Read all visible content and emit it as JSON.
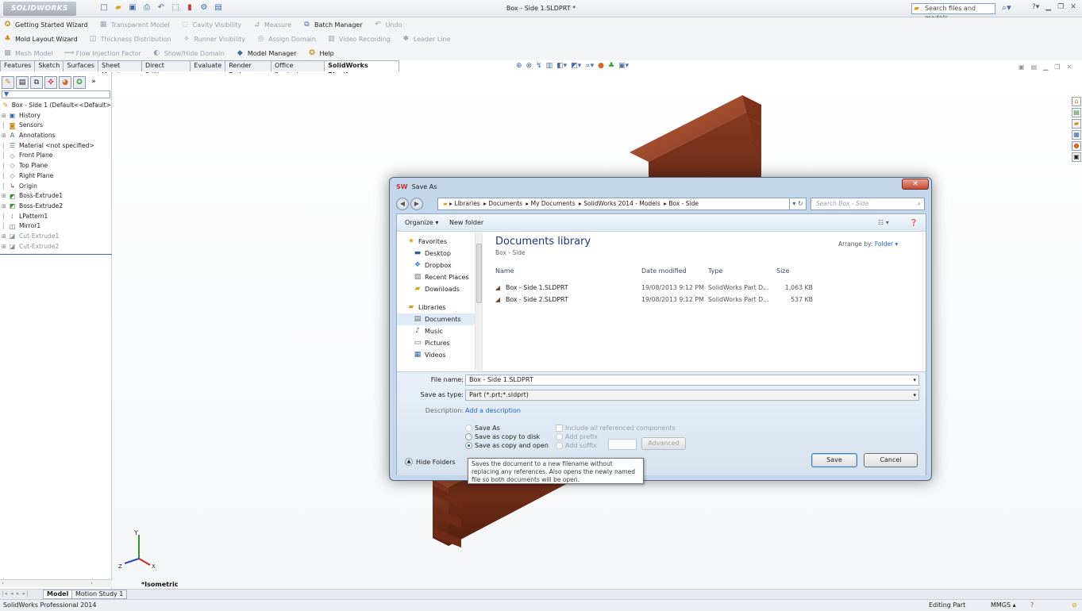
{
  "app": {
    "logo_text": "SOLIDWORKS",
    "document_title": "Box - Side 1.SLDPRT *",
    "search_placeholder": "Search files and models"
  },
  "command_manager": {
    "row1": [
      "Getting Started Wizard",
      "Transparent Model",
      "Cavity Visibility",
      "Measure",
      "Batch Manager",
      "Undo"
    ],
    "row2": [
      "Mold Layout Wizard",
      "Thickness Distribution",
      "Runner Visibility",
      "Assign Domain",
      "Video Recording",
      "Leader Line"
    ],
    "row3": [
      "Mesh Model",
      "Flow Injection Factor",
      "Show/Hide Domain",
      "Model Manager",
      "Help"
    ]
  },
  "tabs": [
    "Features",
    "Sketch",
    "Surfaces",
    "Sheet Metal",
    "Direct Editing",
    "Evaluate",
    "Render Tools",
    "Office Products",
    "SolidWorks Plastics"
  ],
  "feature_tree": {
    "root": "Box - Side 1  (Default<<Default>",
    "items": [
      "History",
      "Sensors",
      "Annotations",
      "Material <not specified>",
      "Front Plane",
      "Top Plane",
      "Right Plane",
      "Origin",
      "Boss-Extrude1",
      "Boss-Extrude2",
      "LPattern1",
      "Mirror1",
      "Cut-Extrude1",
      "Cut-Extrude2"
    ]
  },
  "viewport": {
    "view_label": "*Isometric",
    "wood_color": "#8a3b22",
    "wood_highlight": "#b25a36",
    "wood_shadow": "#55200f"
  },
  "bottom_tabs": [
    "Model",
    "Motion Study 1"
  ],
  "status": {
    "left": "SolidWorks Professional 2014",
    "mode": "Editing Part",
    "units": "MMGS"
  },
  "dialog": {
    "title": "Save As",
    "breadcrumb": [
      "Libraries",
      "Documents",
      "My Documents",
      "SolidWorks 2014 - Models",
      "Box - Side"
    ],
    "search_placeholder": "Search Box - Side",
    "organize": "Organize",
    "new_folder": "New folder",
    "nav": {
      "favorites": "Favorites",
      "desktop": "Desktop",
      "dropbox": "Dropbox",
      "recent": "Recent Places",
      "downloads": "Downloads",
      "libraries": "Libraries",
      "documents": "Documents",
      "music": "Music",
      "pictures": "Pictures",
      "videos": "Videos"
    },
    "library_title": "Documents library",
    "library_subtitle": "Box - Side",
    "arrange_by_label": "Arrange by:",
    "arrange_by_value": "Folder",
    "columns": {
      "name": "Name",
      "date": "Date modified",
      "type": "Type",
      "size": "Size"
    },
    "files": [
      {
        "name": "Box - Side 1.SLDPRT",
        "date": "19/08/2013 9:12 PM",
        "type": "SolidWorks Part D...",
        "size": "1,063 KB"
      },
      {
        "name": "Box - Side 2.SLDPRT",
        "date": "19/08/2013 9:12 PM",
        "type": "SolidWorks Part D...",
        "size": "537 KB"
      }
    ],
    "file_name_label": "File name:",
    "file_name_value": "Box - Side 1.SLDPRT",
    "save_type_label": "Save as type:",
    "save_type_value": "Part (*.prt;*.sldprt)",
    "description_label": "Description:",
    "description_link": "Add a description",
    "radio_save_as": "Save As",
    "radio_copy_disk": "Save as copy to disk",
    "radio_copy_open": "Save as copy and open",
    "include_refs": "Include all referenced components",
    "add_prefix": "Add prefix",
    "add_suffix": "Add suffix",
    "advanced": "Advanced",
    "hide_folders": "Hide Folders",
    "save": "Save",
    "cancel": "Cancel",
    "tooltip": "Saves the document to a new filename without replacing any references. Also opens the newly named file so both documents will be open."
  }
}
